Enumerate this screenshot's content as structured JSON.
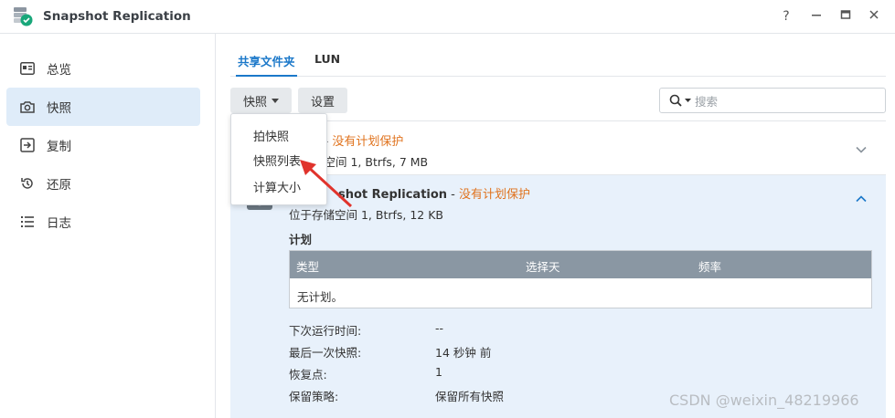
{
  "window": {
    "title": "Snapshot Replication"
  },
  "sidebar": {
    "items": [
      {
        "label": "总览",
        "icon": "overview-icon"
      },
      {
        "label": "快照",
        "icon": "camera-icon"
      },
      {
        "label": "复制",
        "icon": "replication-icon"
      },
      {
        "label": "还原",
        "icon": "restore-icon"
      },
      {
        "label": "日志",
        "icon": "log-list-icon"
      }
    ],
    "active_index": 1
  },
  "tabs": [
    {
      "label": "共享文件夹"
    },
    {
      "label": "LUN"
    }
  ],
  "toolbar": {
    "snapshot_button": "快照",
    "settings_button": "设置"
  },
  "search": {
    "placeholder": "搜索"
  },
  "dropdown": {
    "items": [
      "拍快照",
      "快照列表",
      "计算大小"
    ]
  },
  "rows": [
    {
      "name_fragment": "r",
      "separator": " - ",
      "status": "没有计划保护",
      "location_fragment": "储空间 1, Btrfs, 7 MB"
    },
    {
      "name_fragment": "shot Replication",
      "separator": " - ",
      "status": "没有计划保护",
      "location": "位于存储空间 1, Btrfs, 12 KB"
    }
  ],
  "details": {
    "plan_label": "计划",
    "table_headers": [
      "类型",
      "选择天",
      "频率"
    ],
    "table_empty": "无计划。",
    "fields": [
      {
        "key": "下次运行时间:",
        "value": "--"
      },
      {
        "key": "最后一次快照:",
        "value": "14 秒钟 前"
      },
      {
        "key": "恢复点:",
        "value": "1"
      },
      {
        "key": "保留策略:",
        "value": "保留所有快照"
      }
    ]
  },
  "watermark": "CSDN @weixin_48219966",
  "colors": {
    "accent": "#1b78c9",
    "warning": "#e0731e",
    "selected_bg": "#e8f1fb",
    "arrow": "#e0332c"
  }
}
